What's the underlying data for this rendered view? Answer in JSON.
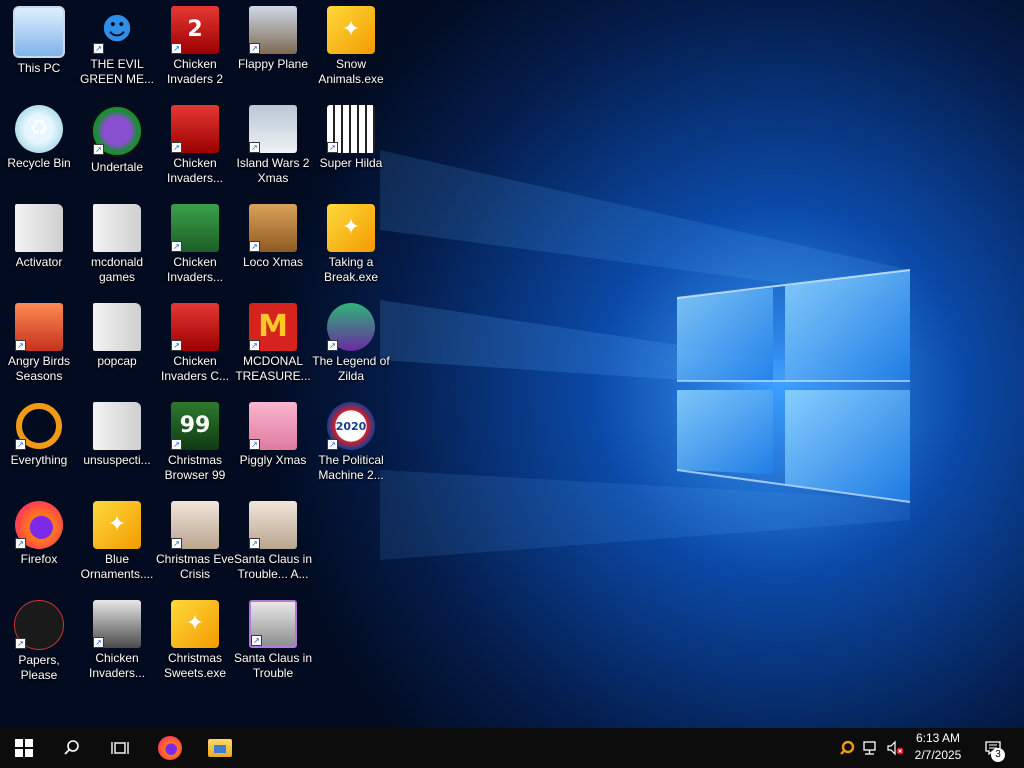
{
  "desktop": {
    "columns": [
      [
        {
          "label": "This PC",
          "icon": "this-pc-icon",
          "style": "pc",
          "glyph": "",
          "shortcut": false
        },
        {
          "label": "Recycle Bin",
          "icon": "recycle-bin-icon",
          "style": "bin",
          "glyph": "♻",
          "shortcut": false
        },
        {
          "label": "Activator",
          "icon": "folder-icon",
          "style": "folder",
          "glyph": "",
          "shortcut": false
        },
        {
          "label": "Angry Birds Seasons",
          "icon": "angry-birds-icon",
          "style": "angry",
          "glyph": "",
          "shortcut": true
        },
        {
          "label": "Everything",
          "icon": "search-ring-icon",
          "style": "ring",
          "glyph": "",
          "shortcut": true
        },
        {
          "label": "Firefox",
          "icon": "firefox-icon",
          "style": "fox",
          "glyph": "",
          "shortcut": true
        },
        {
          "label": "Papers, Please",
          "icon": "papers-please-icon",
          "style": "dark",
          "glyph": "",
          "shortcut": true
        }
      ],
      [
        {
          "label": "THE EVIL GREEN ME...",
          "icon": "messenger-icon",
          "style": "msn",
          "glyph": "☻",
          "shortcut": true
        },
        {
          "label": "Undertale",
          "icon": "undertale-icon",
          "style": "undertale",
          "glyph": "",
          "shortcut": true
        },
        {
          "label": "mcdonald games",
          "icon": "folder-icon",
          "style": "folder",
          "glyph": "",
          "shortcut": false
        },
        {
          "label": "popcap",
          "icon": "folder-icon",
          "style": "folder",
          "glyph": "",
          "shortcut": false
        },
        {
          "label": "unsuspecti...",
          "icon": "folder-icon",
          "style": "folder",
          "glyph": "",
          "shortcut": false
        },
        {
          "label": "Blue Ornaments....",
          "icon": "package-icon",
          "style": "cube",
          "glyph": "✦",
          "shortcut": false
        },
        {
          "label": "Chicken Invaders...",
          "icon": "chicken-invaders-icon",
          "style": "birds",
          "glyph": "",
          "shortcut": true
        }
      ],
      [
        {
          "label": "Chicken Invaders 2",
          "icon": "chicken-invaders-icon",
          "style": "red",
          "glyph": "2",
          "shortcut": true
        },
        {
          "label": "Chicken Invaders...",
          "icon": "chicken-invaders-icon",
          "style": "red",
          "glyph": "",
          "shortcut": true
        },
        {
          "label": "Chicken Invaders...",
          "icon": "chicken-invaders-icon",
          "style": "green",
          "glyph": "",
          "shortcut": true
        },
        {
          "label": "Chicken Invaders C...",
          "icon": "chicken-invaders-icon",
          "style": "red",
          "glyph": "",
          "shortcut": true
        },
        {
          "label": "Christmas Browser 99",
          "icon": "christmas-tree-icon",
          "style": "tree",
          "glyph": "99",
          "shortcut": true
        },
        {
          "label": "Christmas Eve Crisis",
          "icon": "santa-icon",
          "style": "santa",
          "glyph": "",
          "shortcut": true
        },
        {
          "label": "Christmas Sweets.exe",
          "icon": "package-icon",
          "style": "cube",
          "glyph": "✦",
          "shortcut": false
        }
      ],
      [
        {
          "label": "Flappy Plane",
          "icon": "flappy-plane-icon",
          "style": "flappy",
          "glyph": "",
          "shortcut": true
        },
        {
          "label": "Island Wars 2 Xmas",
          "icon": "island-wars-icon",
          "style": "island",
          "glyph": "",
          "shortcut": true
        },
        {
          "label": "Loco Xmas",
          "icon": "teddy-bear-icon",
          "style": "brown",
          "glyph": "",
          "shortcut": true
        },
        {
          "label": "MCDONAL TREASURE...",
          "icon": "mcdonalds-icon",
          "style": "mc",
          "glyph": "M",
          "shortcut": true
        },
        {
          "label": "Piggly Xmas",
          "icon": "pig-icon",
          "style": "pink",
          "glyph": "",
          "shortcut": true
        },
        {
          "label": "Santa Claus in Trouble... A...",
          "icon": "santa-icon",
          "style": "santa",
          "glyph": "",
          "shortcut": true
        },
        {
          "label": "Santa Claus in Trouble",
          "icon": "santa-icon",
          "style": "santa2",
          "glyph": "",
          "shortcut": true
        }
      ],
      [
        {
          "label": "Snow Animals.exe",
          "icon": "package-icon",
          "style": "cube",
          "glyph": "✦",
          "shortcut": false
        },
        {
          "label": "Super Hilda",
          "icon": "super-hilda-icon",
          "style": "hilda",
          "glyph": "",
          "shortcut": true
        },
        {
          "label": "Taking a Break.exe",
          "icon": "package-icon",
          "style": "cube",
          "glyph": "✦",
          "shortcut": false
        },
        {
          "label": "The Legend of Zilda",
          "icon": "zilda-icon",
          "style": "zilda",
          "glyph": "",
          "shortcut": true
        },
        {
          "label": "The Political Machine 2...",
          "icon": "political-machine-icon",
          "style": "polit",
          "glyph": "2020",
          "shortcut": true
        }
      ]
    ]
  },
  "taskbar": {
    "start_icon": "windows-logo-icon",
    "search_icon": "search-icon",
    "task_view_icon": "task-view-icon",
    "pinned": [
      {
        "name": "firefox-taskbar-icon"
      },
      {
        "name": "file-explorer-taskbar-icon"
      }
    ],
    "tray": {
      "time": "6:13 AM",
      "date": "2/7/2025",
      "notification_count": "3"
    }
  },
  "colors": {
    "taskbar": "#0c0c0c",
    "wallpaper_dark": "#02102a",
    "wallpaper_glow": "#2f8cff"
  }
}
